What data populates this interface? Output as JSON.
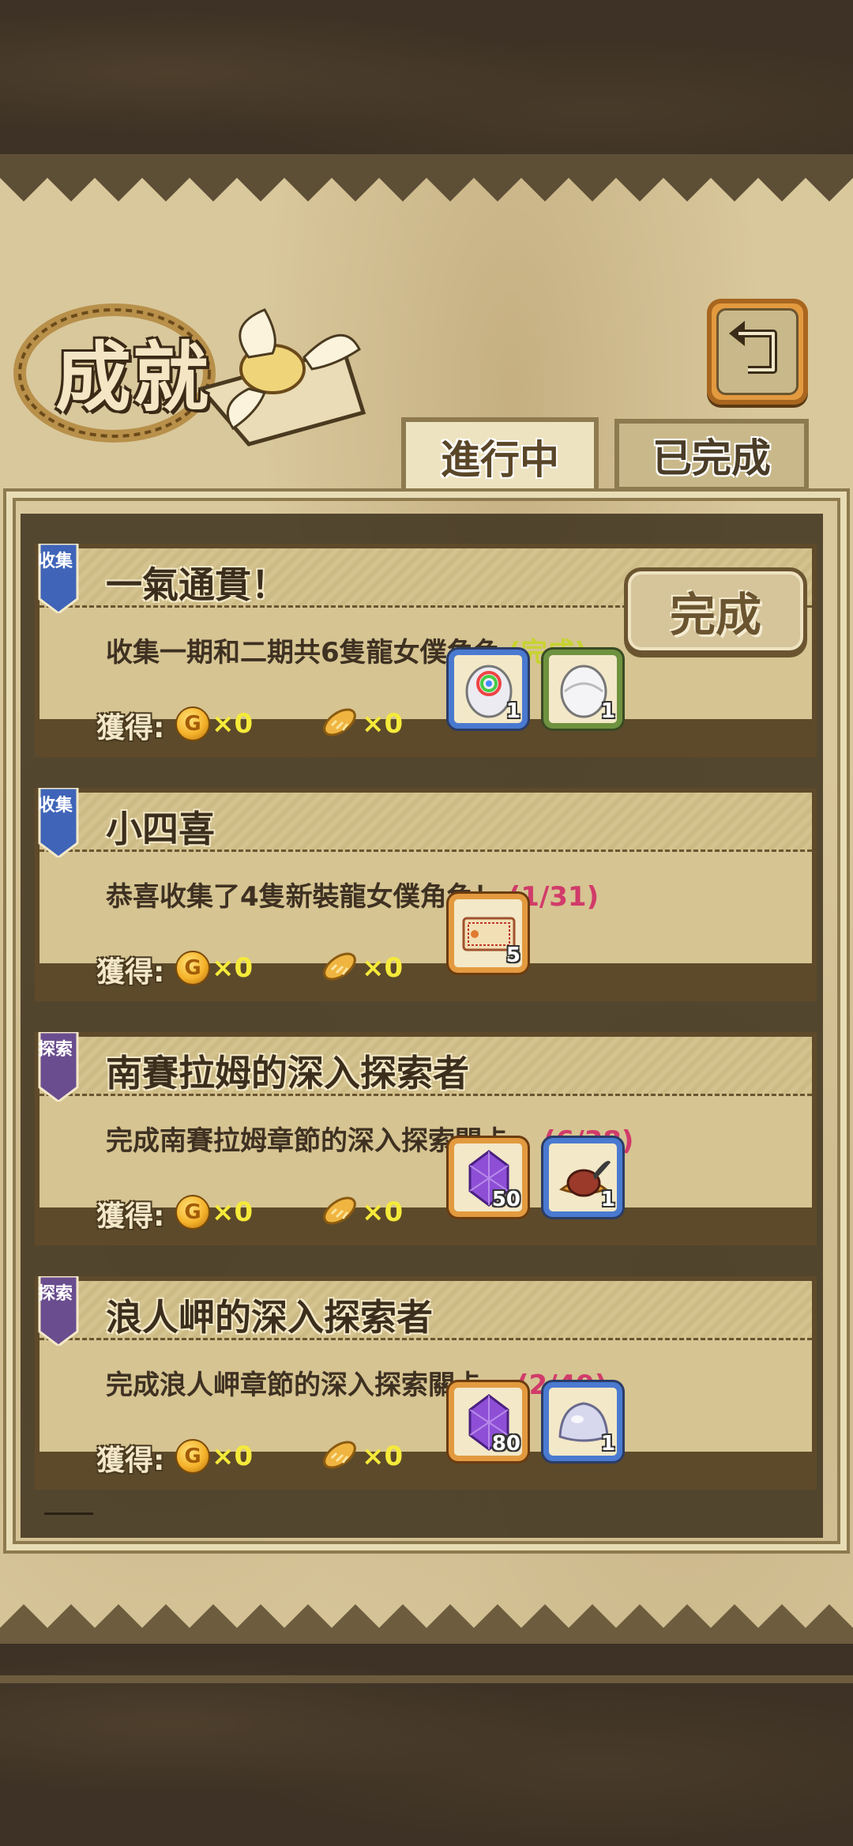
{
  "header": {
    "title": "成就",
    "back_icon": "return-arrow-icon"
  },
  "tabs": [
    {
      "label": "進行中",
      "active": true
    },
    {
      "label": "已完成",
      "active": false
    }
  ],
  "achievements": [
    {
      "category": "收集",
      "category_color": "#3f64b8",
      "title": "一氣通貫！",
      "description": "收集一期和二期共6隻龍女僕角色",
      "progress": "(完成)",
      "reward_label": "獲得:",
      "coin_icon": "G",
      "coin_count": "×0",
      "bread_count": "×0",
      "complete_button": "完成",
      "items": [
        {
          "icon": "rainbow-egg-icon",
          "count": "1",
          "frame": "blue"
        },
        {
          "icon": "white-egg-icon",
          "count": "1",
          "frame": "green"
        }
      ]
    },
    {
      "category": "收集",
      "category_color": "#3f64b8",
      "title": "小四喜",
      "description": "恭喜收集了4隻新裝龍女僕角色！",
      "progress": "(1/31)",
      "reward_label": "獲得:",
      "coin_icon": "G",
      "coin_count": "×0",
      "bread_count": "×0",
      "items": [
        {
          "icon": "ticket-icon",
          "count": "5",
          "frame": "orange"
        }
      ]
    },
    {
      "category": "探索",
      "category_color": "#6a4d8e",
      "title": "南賽拉姆的深入探索者",
      "description": "完成南賽拉姆章節的深入探索關卡。",
      "progress": "(6/38)",
      "reward_label": "獲得:",
      "coin_icon": "G",
      "coin_count": "×0",
      "bread_count": "×0",
      "items": [
        {
          "icon": "purple-crystal-icon",
          "count": "50",
          "frame": "orange"
        },
        {
          "icon": "feather-hat-icon",
          "count": "1",
          "frame": "blue"
        }
      ]
    },
    {
      "category": "探索",
      "category_color": "#6a4d8e",
      "title": "浪人岬的深入探索者",
      "description": "完成浪人岬章節的深入探索關卡。",
      "progress": "(2/49)",
      "reward_label": "獲得:",
      "coin_icon": "G",
      "coin_count": "×0",
      "bread_count": "×0",
      "items": [
        {
          "icon": "purple-crystal-icon",
          "count": "80",
          "frame": "orange"
        },
        {
          "icon": "slime-egg-icon",
          "count": "1",
          "frame": "blue"
        }
      ]
    }
  ]
}
